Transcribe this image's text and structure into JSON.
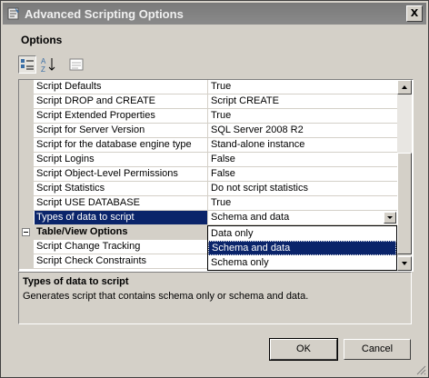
{
  "window": {
    "title": "Advanced Scripting Options",
    "close_label": "X"
  },
  "section_label": "Options",
  "toolbar": {
    "icons": [
      "categorized-icon",
      "alphabetical-sort-icon",
      "property-pages-icon"
    ]
  },
  "properties": [
    {
      "name": "Script Defaults",
      "value": "True"
    },
    {
      "name": "Script DROP and CREATE",
      "value": "Script CREATE"
    },
    {
      "name": "Script Extended Properties",
      "value": "True"
    },
    {
      "name": "Script for Server Version",
      "value": "SQL Server 2008 R2"
    },
    {
      "name": "Script for the database engine type",
      "value": "Stand-alone instance"
    },
    {
      "name": "Script Logins",
      "value": "False"
    },
    {
      "name": "Script Object-Level Permissions",
      "value": "False"
    },
    {
      "name": "Script Statistics",
      "value": "Do not script statistics"
    },
    {
      "name": "Script USE DATABASE",
      "value": "True"
    },
    {
      "name": "Types of data to script",
      "value": "Schema and data",
      "selected": true
    }
  ],
  "category": {
    "name": "Table/View Options"
  },
  "category_properties": [
    {
      "name": "Script Change Tracking"
    },
    {
      "name": "Script Check Constraints"
    }
  ],
  "dropdown": {
    "options": [
      "Data only",
      "Schema and data",
      "Schema only"
    ],
    "selected_index": 1
  },
  "description": {
    "title": "Types of data to script",
    "text": "Generates script that contains schema only or schema and data."
  },
  "buttons": {
    "ok": "OK",
    "cancel": "Cancel"
  },
  "colors": {
    "selection": "#0a246a",
    "face": "#d4d0c8",
    "titlebar": "#808080"
  }
}
